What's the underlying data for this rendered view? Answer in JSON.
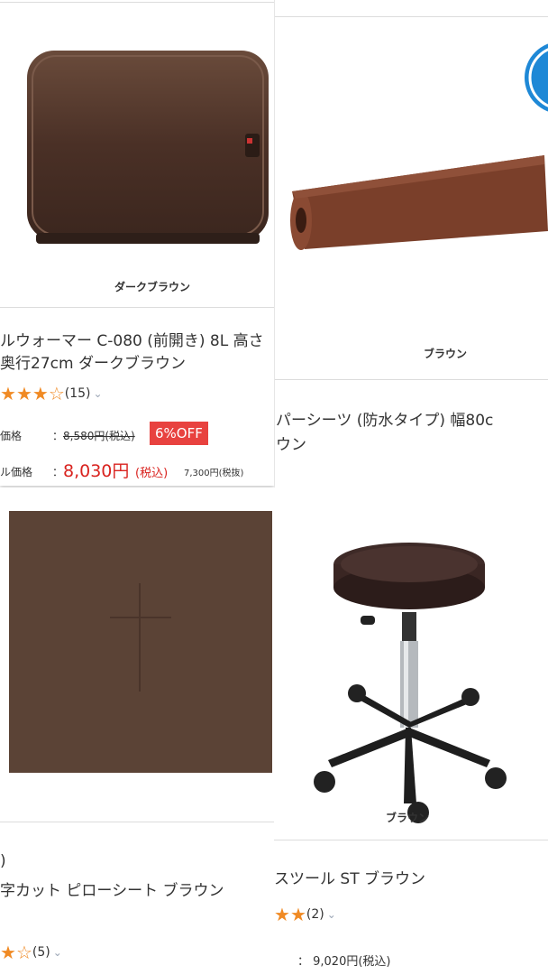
{
  "products": [
    {
      "variant_caption": "ダークブラウン",
      "title_line1": "ルウォーマー C-080 (前開き) 8L 高さ",
      "title_line2": "奥行27cm ダークブラウン",
      "rating_count": "(15)",
      "rating_stars": 3,
      "list_price_label": "価格",
      "list_price": "8,580円(税込)",
      "discount_badge": "6%OFF",
      "sale_price_label": "ル価格",
      "sale_price_separator": "：",
      "sale_price": "8,030円",
      "sale_price_tax": "(税込)",
      "sale_price_ex_tax": "7,300円(税抜)"
    },
    {
      "variant_caption": "ブラウン",
      "title_line1": "パーシーツ (防水タイプ) 幅80c",
      "title_line2": "ウン"
    },
    {
      "badge_fragment": ")",
      "title_line1": "字カット ピローシート ブラウン",
      "rating_count": "(5)",
      "rating_stars": 1
    },
    {
      "variant_caption": "ブラウン",
      "title_line1": "スツール ST ブラウン",
      "rating_count": "(2)",
      "rating_stars": 2,
      "price": "： 9,020円(税込)"
    }
  ],
  "icons": {
    "star_filled": "★",
    "star_empty": "☆",
    "chevron": "⌄"
  },
  "colors": {
    "accent_orange": "#f08a24",
    "sale_red": "#d9231f",
    "badge_red": "#e8423f",
    "product_brown": "#5a4033"
  }
}
